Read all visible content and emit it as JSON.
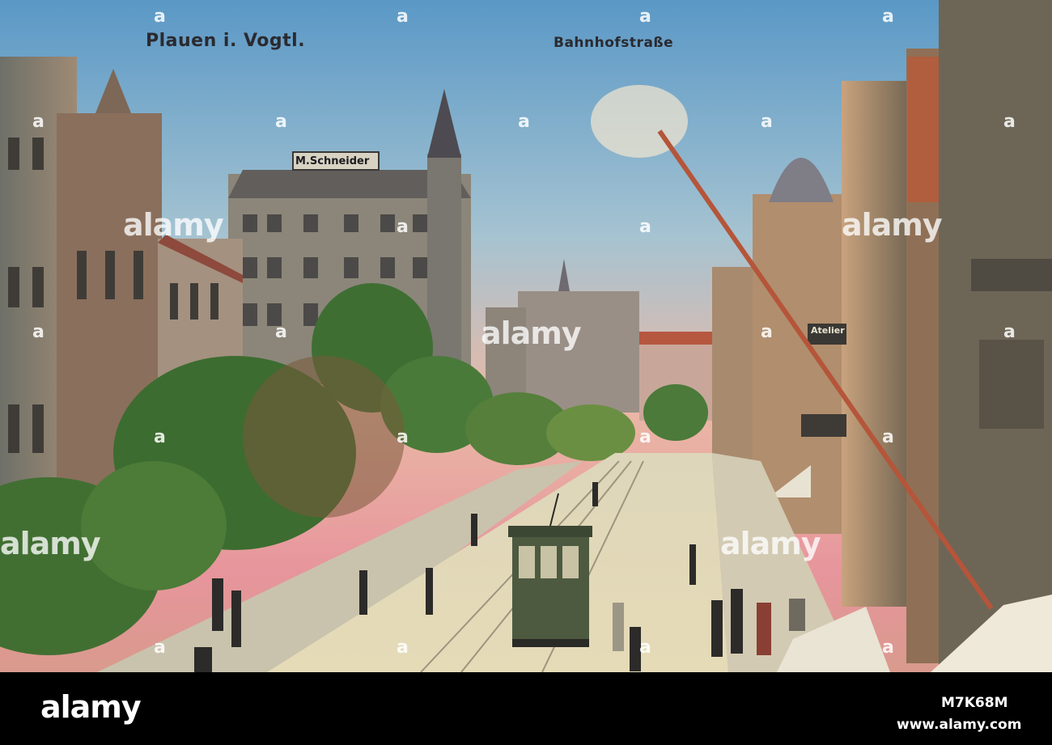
{
  "postcard": {
    "caption_left": "Plauen i. Vogtl.",
    "caption_right": "Bahnhofstraße",
    "shop_sign": "M.Schneider",
    "atelier_sign": "Atelier"
  },
  "watermark": {
    "brand": "alamy",
    "overlay_text": "alamy",
    "dot": "a"
  },
  "footer": {
    "image_ref": "M7K68M",
    "site": "www.alamy.com"
  },
  "colors": {
    "sky_top": "#5f9cc7",
    "sky_pink": "#e9a0a3",
    "street": "#e4dab8",
    "trees": "#3b6b2f",
    "buildings": "#8d8574",
    "footer_bg": "#000000"
  }
}
